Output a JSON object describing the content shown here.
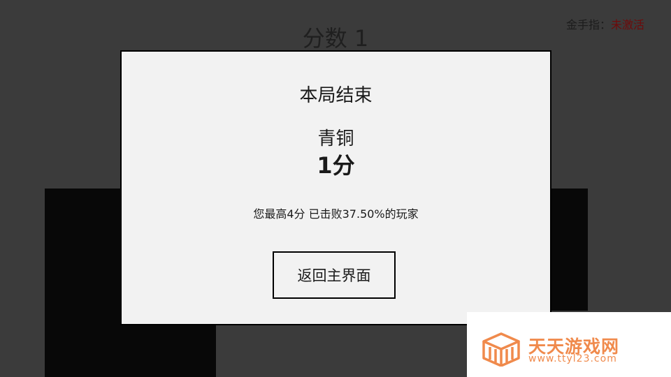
{
  "game": {
    "score_label": "分数 1",
    "cheat_label": "金手指：",
    "cheat_value": "未激活"
  },
  "modal": {
    "title": "本局结束",
    "rank": "青铜",
    "score": "1分",
    "stats": "您最高4分 已击败37.50%的玩家",
    "return_button": "返回主界面"
  },
  "watermark": {
    "name": "天天游戏网",
    "url": "www.ttyl23.com",
    "icon": "building-logo-icon"
  },
  "colors": {
    "background": "#3b3b3b",
    "modal_bg": "#f2f2f2",
    "tile": "#080808",
    "cheat_inactive": "#6e0a0a",
    "watermark_accent": "#f08a4c"
  }
}
